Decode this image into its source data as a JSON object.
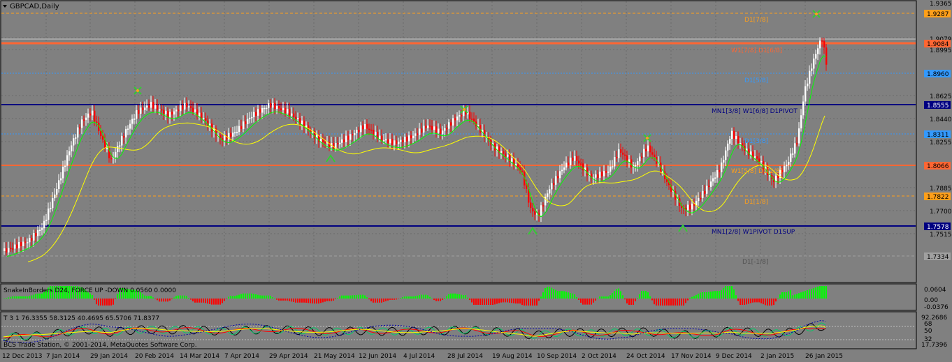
{
  "window": {
    "title": "GBPCAD,Daily"
  },
  "main_chart": {
    "y_ticks": [
      "1.9365",
      "1.9079",
      "1.8995",
      "1.8625",
      "1.8440",
      "1.8255",
      "1.7885",
      "1.7700",
      "1.7515"
    ],
    "price_boxes": [
      {
        "label": "1.9287",
        "color": "#ff9f1a"
      },
      {
        "label": "1.9084",
        "color": "#ff6633"
      },
      {
        "label": "1.8960",
        "color": "#3399ff"
      },
      {
        "label": "1.8555",
        "color": "#000080"
      },
      {
        "label": "1.8311",
        "color": "#3399ff"
      },
      {
        "label": "1.8066",
        "color": "#ff6633"
      },
      {
        "label": "1.7822",
        "color": "#ff9f1a"
      },
      {
        "label": "1.7578",
        "color": "#000080"
      },
      {
        "label": "1.7334",
        "color": "#a0a0a0"
      }
    ],
    "level_labels": [
      {
        "text": "D1[7/8]",
        "color": "#ff9f1a"
      },
      {
        "text": "W1[7/8] D1[6/8]",
        "color": "#ff6633"
      },
      {
        "text": "D1[5/8]",
        "color": "#3399ff"
      },
      {
        "text": "MN1[3/8] W1[6/8] D1PIVOT",
        "color": "#000080"
      },
      {
        "text": "D1[3/8]",
        "color": "#3399ff"
      },
      {
        "text": "W1[5/8] D1[2/8]",
        "color": "#ff9f1a"
      },
      {
        "text": "D1[1/8]",
        "color": "#ff9f1a"
      },
      {
        "text": "MN1[2/8] W1PIVOT D1SUP",
        "color": "#000080"
      },
      {
        "text": "D1[-1/8]",
        "color": "#505050"
      }
    ]
  },
  "indicator1": {
    "title": "SnakeInBorders D24, FORCE UP -DOWN 0.0560 0.0000",
    "y_ticks": [
      "0.0604",
      "0.00",
      "-0.0376"
    ]
  },
  "indicator2": {
    "title": "T 3 1 76.3355 58.3125 40.4695 65.5706 71.8377",
    "y_ticks": [
      "92.2686",
      "68",
      "50",
      "32",
      "17.7396"
    ]
  },
  "x_axis": [
    "12 Dec 2013",
    "7 Jan 2014",
    "29 Jan 2014",
    "20 Feb 2014",
    "14 Mar 2014",
    "7 Apr 2014",
    "29 Apr 2014",
    "21 May 2014",
    "12 Jun 2014",
    "4 Jul 2014",
    "28 Jul 2014",
    "19 Aug 2014",
    "10 Sep 2014",
    "2 Oct 2014",
    "24 Oct 2014",
    "17 Nov 2014",
    "9 Dec 2014",
    "2 Jan 2015",
    "26 Jan 2015"
  ],
  "copyright": "BCS Trade Station, © 2001-2014, MetaQuotes Software Corp.",
  "colors": {
    "bull": "#ffffff",
    "bear": "#ff0000",
    "ma_slow": "#ffff00",
    "ma_fast": "#00ff00",
    "background": "#808080"
  }
}
